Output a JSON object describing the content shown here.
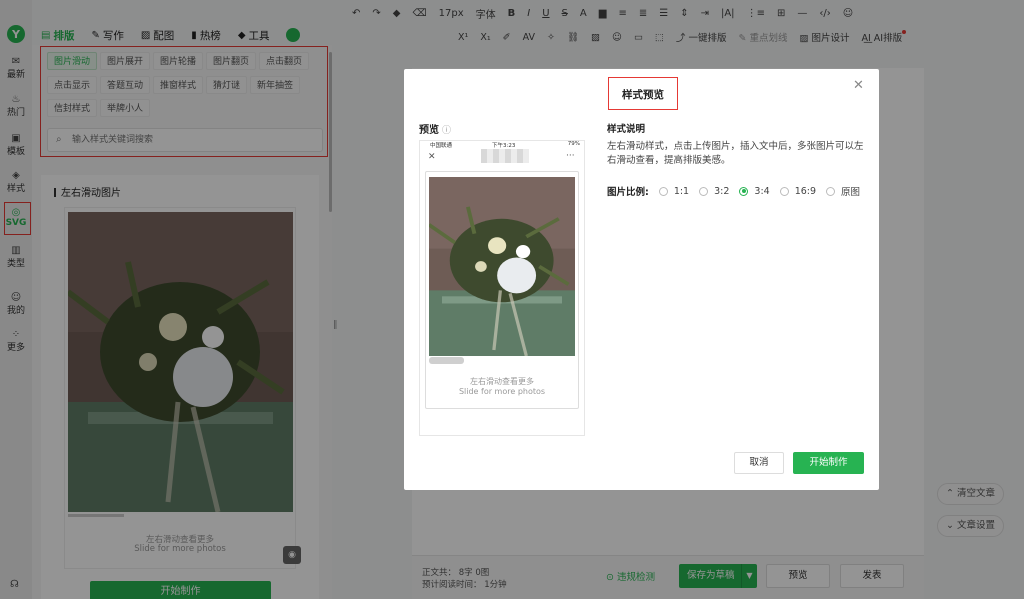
{
  "colors": {
    "accent": "#27b352",
    "highlight_box": "#e53935"
  },
  "rail": {
    "logo": "Y",
    "items": [
      {
        "label": "最新",
        "icon": "envelope-icon"
      },
      {
        "label": "热门",
        "icon": "flame-icon"
      },
      {
        "label": "模板",
        "icon": "template-icon"
      },
      {
        "label": "样式",
        "icon": "style-icon"
      },
      {
        "label": "SVG",
        "icon": "svg-icon",
        "active": true
      },
      {
        "label": "类型",
        "icon": "grid-icon"
      },
      {
        "label": "我的",
        "icon": "user-icon"
      },
      {
        "label": "更多",
        "icon": "more-icon"
      }
    ]
  },
  "nav": {
    "tabs": [
      {
        "label": "排版",
        "icon": "layout-icon",
        "active": true
      },
      {
        "label": "写作",
        "icon": "pen-icon"
      },
      {
        "label": "配图",
        "icon": "image-icon"
      },
      {
        "label": "热榜",
        "icon": "bookmark-icon"
      },
      {
        "label": "工具",
        "icon": "cube-icon"
      }
    ]
  },
  "toolbar": {
    "font_size": "17px",
    "font": "字体",
    "row2": {
      "one_click": "一键排版",
      "focus": "重点划线",
      "image_design": "图片设计",
      "ai": "AI排版"
    }
  },
  "panel": {
    "tags": [
      "图片滑动",
      "图片展开",
      "图片轮播",
      "图片翻页",
      "点击翻页",
      "点击显示",
      "答题互动",
      "推窗样式",
      "猜灯谜",
      "新年抽签",
      "信封样式",
      "举牌小人"
    ],
    "search_placeholder": "输入样式关键词搜索",
    "card_title": "左右滑动图片",
    "card_hint_cn": "左右滑动查看更多",
    "card_hint_en": "Slide for more photos",
    "start_button": "开始制作"
  },
  "editor": {
    "side_buttons": [
      "清空文章",
      "文章设置"
    ],
    "stats": {
      "body_label": "正文共：",
      "body_value": "8字 0图",
      "time_label": "预计阅读时间：",
      "time_value": "1分钟"
    },
    "check": "违规检测",
    "save": "保存为草稿",
    "preview": "预览",
    "publish": "发表"
  },
  "modal": {
    "title": "样式预览",
    "preview_label": "预览",
    "phone": {
      "carrier": "中国联通",
      "time": "下午3:23",
      "battery": "79%",
      "hint_cn": "左右滑动查看更多",
      "hint_en": "Slide for more photos"
    },
    "desc_title": "样式说明",
    "desc": "左右滑动样式，点击上传图片，插入文中后，多张图片可以左右滑动查看，提高排版美感。",
    "ratio_label": "图片比例:",
    "ratios": [
      "1:1",
      "3:2",
      "3:4",
      "16:9",
      "原图"
    ],
    "ratio_selected": "3:4",
    "cancel": "取消",
    "start": "开始制作"
  }
}
